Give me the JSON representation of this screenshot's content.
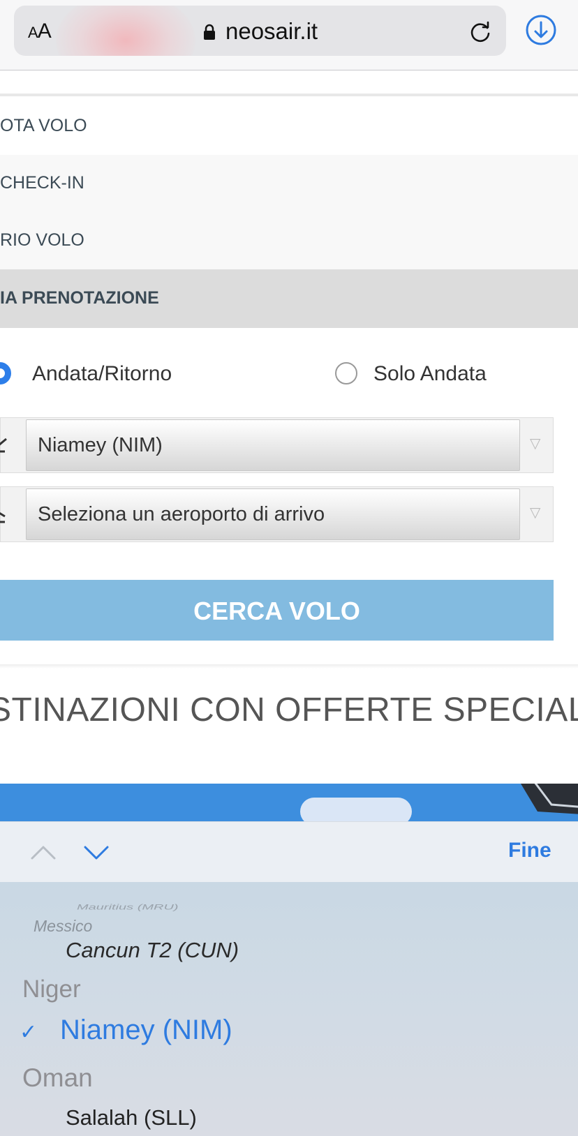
{
  "browser": {
    "text_size_label": "AA",
    "url": "neosair.it"
  },
  "menu": {
    "items": [
      {
        "label": "OTA VOLO"
      },
      {
        "label": "CHECK-IN"
      },
      {
        "label": "RIO VOLO"
      },
      {
        "label": "IA PRENOTAZIONE"
      }
    ]
  },
  "booking": {
    "trip_types": [
      {
        "label": "Andata/Ritorno",
        "selected": true
      },
      {
        "label": "Solo Andata",
        "selected": false
      }
    ],
    "departure_value": "Niamey (NIM)",
    "arrival_placeholder": "Seleziona un aeroporto di arrivo",
    "search_label": "CERCA VOLO"
  },
  "offers": {
    "heading": "STINAZIONI CON OFFERTE SPECIALI"
  },
  "picker": {
    "done_label": "Fine",
    "items": [
      {
        "label": "Mauritius (MRU)",
        "kind": "faded"
      },
      {
        "label": "Messico",
        "kind": "group"
      },
      {
        "label": "Cancun T2 (CUN)",
        "kind": "option"
      },
      {
        "label": "Niger",
        "kind": "group"
      },
      {
        "label": "Niamey (NIM)",
        "kind": "selected"
      },
      {
        "label": "Oman",
        "kind": "group"
      },
      {
        "label": "Salalah (SLL)",
        "kind": "option"
      }
    ],
    "check_mark": "✓"
  },
  "colors": {
    "accent": "#2e7be0",
    "search_button": "#83bbe0",
    "section_header": "#dcdcdc"
  }
}
